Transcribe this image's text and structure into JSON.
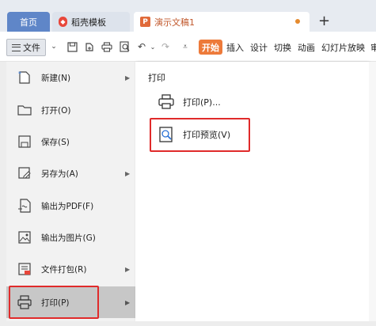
{
  "tabs": {
    "home": "首页",
    "template": "稻壳模板",
    "document": "演示文稿1",
    "add": "+"
  },
  "toolbar": {
    "file_label": "文件",
    "ribbon": [
      "开始",
      "插入",
      "设计",
      "切换",
      "动画",
      "幻灯片放映",
      "审"
    ]
  },
  "file_menu": {
    "items": [
      {
        "label": "新建(N)",
        "icon": "new-file-icon",
        "submenu": true
      },
      {
        "label": "打开(O)",
        "icon": "folder-open-icon",
        "submenu": false
      },
      {
        "label": "保存(S)",
        "icon": "save-icon",
        "submenu": false
      },
      {
        "label": "另存为(A)",
        "icon": "save-as-icon",
        "submenu": true
      },
      {
        "label": "输出为PDF(F)",
        "icon": "export-pdf-icon",
        "submenu": false
      },
      {
        "label": "输出为图片(G)",
        "icon": "export-image-icon",
        "submenu": false
      },
      {
        "label": "文件打包(R)",
        "icon": "package-icon",
        "submenu": true
      },
      {
        "label": "打印(P)",
        "icon": "printer-icon",
        "submenu": true
      }
    ],
    "active_index": 7
  },
  "print_panel": {
    "title": "打印",
    "items": [
      {
        "label": "打印(P)...",
        "icon": "printer-icon"
      },
      {
        "label": "打印预览(V)",
        "icon": "print-preview-icon"
      }
    ]
  },
  "colors": {
    "highlight": "#e02a2a",
    "accent": "#ed7a3a",
    "home_tab": "#5f86c8"
  }
}
